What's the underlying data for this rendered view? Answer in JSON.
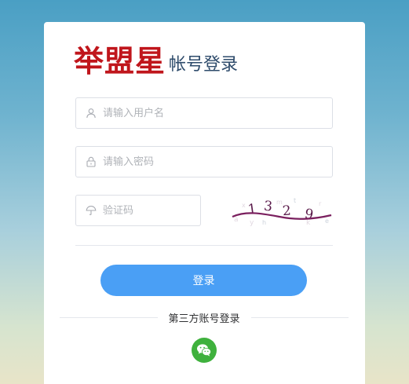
{
  "header": {
    "brand": "举盟星",
    "subtitle": "帐号登录"
  },
  "form": {
    "username_placeholder": "请输入用户名",
    "password_placeholder": "请输入密码",
    "code_placeholder": "验证码",
    "captcha_text": "1329"
  },
  "actions": {
    "login_label": "登录",
    "third_party_label": "第三方账号登录"
  },
  "icons": {
    "username": "user-icon",
    "password": "lock-icon",
    "code": "umbrella-icon",
    "social": "wechat-icon"
  },
  "colors": {
    "brand": "#c0161c",
    "subtitle": "#2e4b6b",
    "button": "#4a9ff5",
    "wechat": "#3fb13d"
  }
}
